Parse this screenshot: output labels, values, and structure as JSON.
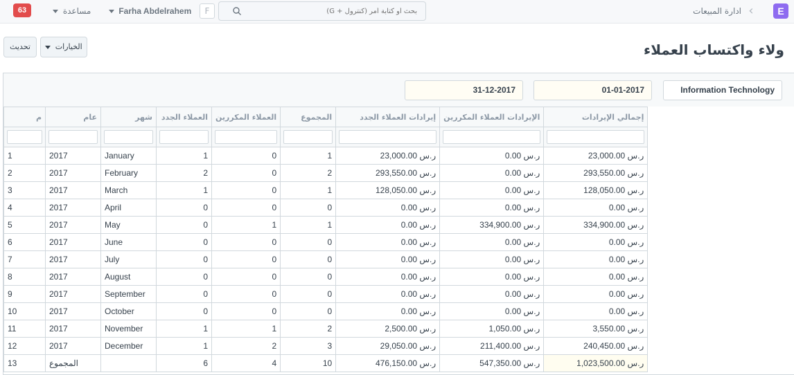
{
  "navbar": {
    "brand_letter": "E",
    "breadcrumb": "ادارة المبيعات",
    "search_placeholder": "بحث أو كتابة أمر (كنترول + G)",
    "user_initial": "F",
    "user_name": "Farha Abdelrahem",
    "help_label": "مساعدة",
    "notifications_count": "63"
  },
  "page": {
    "title": "ولاء واكتساب العملاء",
    "options_label": "الخيارات",
    "refresh_label": "تحديث"
  },
  "filters": {
    "company": "Information Technology",
    "from_date": "01-01-2017",
    "to_date": "31-12-2017"
  },
  "table": {
    "columns": [
      "م",
      "عام",
      "شهر",
      "العملاء الجدد",
      "العملاء المكررين",
      "المجموع",
      "إيرادات العملاء الجدد",
      "الإيرادات العملاء المكررين",
      "إجمالي الإيرادات"
    ],
    "rows": [
      {
        "idx": "1",
        "year": "2017",
        "month": "January",
        "new_customers": "1",
        "repeat_customers": "0",
        "total": "1",
        "new_revenue": "ر.س 23,000.00",
        "repeat_revenue": "ر.س 0.00",
        "total_revenue": "ر.س 23,000.00"
      },
      {
        "idx": "2",
        "year": "2017",
        "month": "February",
        "new_customers": "2",
        "repeat_customers": "0",
        "total": "2",
        "new_revenue": "ر.س 293,550.00",
        "repeat_revenue": "ر.س 0.00",
        "total_revenue": "ر.س 293,550.00"
      },
      {
        "idx": "3",
        "year": "2017",
        "month": "March",
        "new_customers": "1",
        "repeat_customers": "0",
        "total": "1",
        "new_revenue": "ر.س 128,050.00",
        "repeat_revenue": "ر.س 0.00",
        "total_revenue": "ر.س 128,050.00"
      },
      {
        "idx": "4",
        "year": "2017",
        "month": "April",
        "new_customers": "0",
        "repeat_customers": "0",
        "total": "0",
        "new_revenue": "ر.س 0.00",
        "repeat_revenue": "ر.س 0.00",
        "total_revenue": "ر.س 0.00"
      },
      {
        "idx": "5",
        "year": "2017",
        "month": "May",
        "new_customers": "0",
        "repeat_customers": "1",
        "total": "1",
        "new_revenue": "ر.س 0.00",
        "repeat_revenue": "ر.س 334,900.00",
        "total_revenue": "ر.س 334,900.00"
      },
      {
        "idx": "6",
        "year": "2017",
        "month": "June",
        "new_customers": "0",
        "repeat_customers": "0",
        "total": "0",
        "new_revenue": "ر.س 0.00",
        "repeat_revenue": "ر.س 0.00",
        "total_revenue": "ر.س 0.00"
      },
      {
        "idx": "7",
        "year": "2017",
        "month": "July",
        "new_customers": "0",
        "repeat_customers": "0",
        "total": "0",
        "new_revenue": "ر.س 0.00",
        "repeat_revenue": "ر.س 0.00",
        "total_revenue": "ر.س 0.00"
      },
      {
        "idx": "8",
        "year": "2017",
        "month": "August",
        "new_customers": "0",
        "repeat_customers": "0",
        "total": "0",
        "new_revenue": "ر.س 0.00",
        "repeat_revenue": "ر.س 0.00",
        "total_revenue": "ر.س 0.00"
      },
      {
        "idx": "9",
        "year": "2017",
        "month": "September",
        "new_customers": "0",
        "repeat_customers": "0",
        "total": "0",
        "new_revenue": "ر.س 0.00",
        "repeat_revenue": "ر.س 0.00",
        "total_revenue": "ر.س 0.00"
      },
      {
        "idx": "10",
        "year": "2017",
        "month": "October",
        "new_customers": "0",
        "repeat_customers": "0",
        "total": "0",
        "new_revenue": "ر.س 0.00",
        "repeat_revenue": "ر.س 0.00",
        "total_revenue": "ر.س 0.00"
      },
      {
        "idx": "11",
        "year": "2017",
        "month": "November",
        "new_customers": "1",
        "repeat_customers": "1",
        "total": "2",
        "new_revenue": "ر.س 2,500.00",
        "repeat_revenue": "ر.س 1,050.00",
        "total_revenue": "ر.س 3,550.00"
      },
      {
        "idx": "12",
        "year": "2017",
        "month": "December",
        "new_customers": "1",
        "repeat_customers": "2",
        "total": "3",
        "new_revenue": "ر.س 29,050.00",
        "repeat_revenue": "ر.س 211,400.00",
        "total_revenue": "ر.س 240,450.00"
      }
    ],
    "total_row": {
      "idx": "13",
      "year": "المجموع",
      "month": "",
      "new_customers": "6",
      "repeat_customers": "4",
      "total": "10",
      "new_revenue": "ر.س 476,150.00",
      "repeat_revenue": "ر.س 547,350.00",
      "total_revenue": "ر.س 1,023,500.00"
    }
  }
}
